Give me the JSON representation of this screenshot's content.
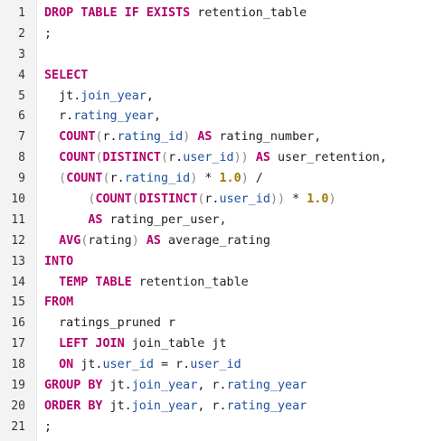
{
  "editor": {
    "lines": [
      {
        "num": "1",
        "tokens": [
          {
            "t": "DROP TABLE IF EXISTS",
            "c": "k"
          },
          {
            "t": " retention_table",
            "c": "t"
          }
        ]
      },
      {
        "num": "2",
        "tokens": [
          {
            "t": ";",
            "c": "t"
          }
        ]
      },
      {
        "num": "3",
        "tokens": []
      },
      {
        "num": "4",
        "tokens": [
          {
            "t": "SELECT",
            "c": "k"
          }
        ]
      },
      {
        "num": "5",
        "tokens": [
          {
            "t": "  jt.",
            "c": "t"
          },
          {
            "t": "join_year",
            "c": "v"
          },
          {
            "t": ",",
            "c": "t"
          }
        ]
      },
      {
        "num": "6",
        "tokens": [
          {
            "t": "  r.",
            "c": "t"
          },
          {
            "t": "rating_year",
            "c": "v"
          },
          {
            "t": ",",
            "c": "t"
          }
        ]
      },
      {
        "num": "7",
        "tokens": [
          {
            "t": "  ",
            "c": "t"
          },
          {
            "t": "COUNT",
            "c": "k"
          },
          {
            "t": "(",
            "c": "p"
          },
          {
            "t": "r.",
            "c": "t"
          },
          {
            "t": "rating_id",
            "c": "v"
          },
          {
            "t": ")",
            "c": "p"
          },
          {
            "t": " ",
            "c": "t"
          },
          {
            "t": "AS",
            "c": "k"
          },
          {
            "t": " rating_number,",
            "c": "t"
          }
        ]
      },
      {
        "num": "8",
        "tokens": [
          {
            "t": "  ",
            "c": "t"
          },
          {
            "t": "COUNT",
            "c": "k"
          },
          {
            "t": "(",
            "c": "p"
          },
          {
            "t": "DISTINCT",
            "c": "k"
          },
          {
            "t": "(",
            "c": "p"
          },
          {
            "t": "r.",
            "c": "t"
          },
          {
            "t": "user_id",
            "c": "v"
          },
          {
            "t": "))",
            "c": "p"
          },
          {
            "t": " ",
            "c": "t"
          },
          {
            "t": "AS",
            "c": "k"
          },
          {
            "t": " user_retention,",
            "c": "t"
          }
        ]
      },
      {
        "num": "9",
        "tokens": [
          {
            "t": "  ",
            "c": "t"
          },
          {
            "t": "(",
            "c": "p"
          },
          {
            "t": "COUNT",
            "c": "k"
          },
          {
            "t": "(",
            "c": "p"
          },
          {
            "t": "r.",
            "c": "t"
          },
          {
            "t": "rating_id",
            "c": "v"
          },
          {
            "t": ")",
            "c": "p"
          },
          {
            "t": " * ",
            "c": "t"
          },
          {
            "t": "1.0",
            "c": "n"
          },
          {
            "t": ")",
            "c": "p"
          },
          {
            "t": " /",
            "c": "t"
          }
        ]
      },
      {
        "num": "10",
        "tokens": [
          {
            "t": "      ",
            "c": "t"
          },
          {
            "t": "(",
            "c": "p"
          },
          {
            "t": "COUNT",
            "c": "k"
          },
          {
            "t": "(",
            "c": "p"
          },
          {
            "t": "DISTINCT",
            "c": "k"
          },
          {
            "t": "(",
            "c": "p"
          },
          {
            "t": "r.",
            "c": "t"
          },
          {
            "t": "user_id",
            "c": "v"
          },
          {
            "t": "))",
            "c": "p"
          },
          {
            "t": " * ",
            "c": "t"
          },
          {
            "t": "1.0",
            "c": "n"
          },
          {
            "t": ")",
            "c": "p"
          }
        ]
      },
      {
        "num": "11",
        "tokens": [
          {
            "t": "      ",
            "c": "t"
          },
          {
            "t": "AS",
            "c": "k"
          },
          {
            "t": " rating_per_user,",
            "c": "t"
          }
        ]
      },
      {
        "num": "12",
        "tokens": [
          {
            "t": "  ",
            "c": "t"
          },
          {
            "t": "AVG",
            "c": "k"
          },
          {
            "t": "(",
            "c": "p"
          },
          {
            "t": "rating",
            "c": "t"
          },
          {
            "t": ")",
            "c": "p"
          },
          {
            "t": " ",
            "c": "t"
          },
          {
            "t": "AS",
            "c": "k"
          },
          {
            "t": " average_rating",
            "c": "t"
          }
        ]
      },
      {
        "num": "13",
        "tokens": [
          {
            "t": "INTO",
            "c": "k"
          }
        ]
      },
      {
        "num": "14",
        "tokens": [
          {
            "t": "  ",
            "c": "t"
          },
          {
            "t": "TEMP TABLE",
            "c": "k"
          },
          {
            "t": " retention_table",
            "c": "t"
          }
        ]
      },
      {
        "num": "15",
        "tokens": [
          {
            "t": "FROM",
            "c": "k"
          }
        ]
      },
      {
        "num": "16",
        "tokens": [
          {
            "t": "  ratings_pruned r",
            "c": "t"
          }
        ]
      },
      {
        "num": "17",
        "tokens": [
          {
            "t": "  ",
            "c": "t"
          },
          {
            "t": "LEFT JOIN",
            "c": "k"
          },
          {
            "t": " join_table jt",
            "c": "t"
          }
        ]
      },
      {
        "num": "18",
        "tokens": [
          {
            "t": "  ",
            "c": "t"
          },
          {
            "t": "ON",
            "c": "k"
          },
          {
            "t": " jt.",
            "c": "t"
          },
          {
            "t": "user_id",
            "c": "v"
          },
          {
            "t": " = r.",
            "c": "t"
          },
          {
            "t": "user_id",
            "c": "v"
          }
        ]
      },
      {
        "num": "19",
        "tokens": [
          {
            "t": "GROUP BY",
            "c": "k"
          },
          {
            "t": " jt.",
            "c": "t"
          },
          {
            "t": "join_year",
            "c": "v"
          },
          {
            "t": ", r.",
            "c": "t"
          },
          {
            "t": "rating_year",
            "c": "v"
          }
        ]
      },
      {
        "num": "20",
        "tokens": [
          {
            "t": "ORDER BY",
            "c": "k"
          },
          {
            "t": " jt.",
            "c": "t"
          },
          {
            "t": "join_year",
            "c": "v"
          },
          {
            "t": ", r.",
            "c": "t"
          },
          {
            "t": "rating_year",
            "c": "v"
          }
        ]
      },
      {
        "num": "21",
        "tokens": [
          {
            "t": ";",
            "c": "t"
          }
        ]
      }
    ]
  }
}
